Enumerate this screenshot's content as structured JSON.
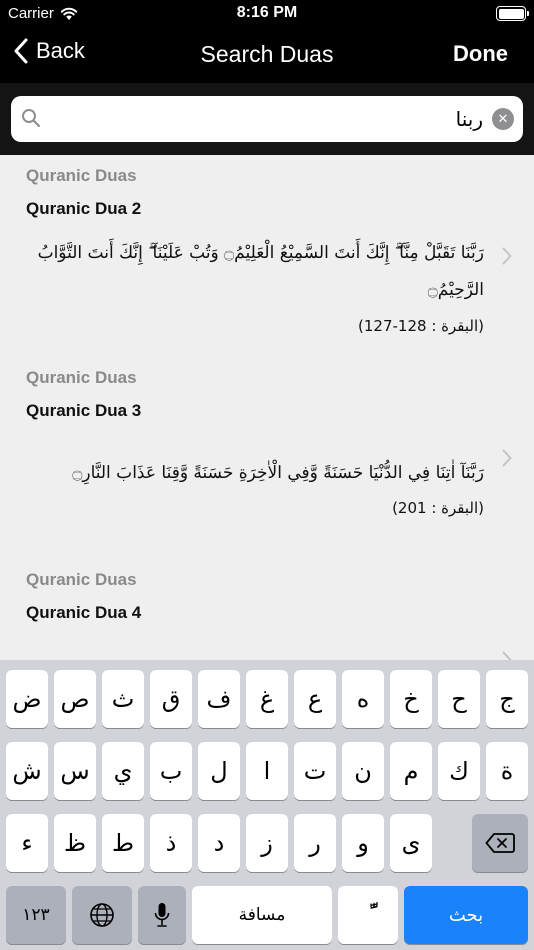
{
  "status": {
    "carrier": "Carrier",
    "time": "8:16 PM"
  },
  "nav": {
    "back_label": "Back",
    "title": "Search Duas",
    "done_label": "Done"
  },
  "search": {
    "value": "ربنا"
  },
  "results": [
    {
      "category": "Quranic Duas",
      "title": "Quranic Dua 2",
      "arabic": "رَبَّنَا تَقَبَّلْ مِنَّآ ۖ إِنَّكَ أَنتَ السَّمِيْعُ الْعَلِيْمُ۝ وَتُبْ عَلَيْنَآ ۖ إِنَّكَ أَنتَ التَّوَّابُ الرَّحِيْمُ۝",
      "reference": "(البقرة : 128-127)"
    },
    {
      "category": "Quranic Duas",
      "title": "Quranic Dua 3",
      "arabic": "رَبَّنَآ اٰتِنَا فِي الدُّنْيَا حَسَنَةً وَّفِي الْاٰخِرَةِ حَسَنَةً وَّقِنَا عَذَابَ النَّارِ۝",
      "reference": "(البقرة : 201)"
    },
    {
      "category": "Quranic Duas",
      "title": "Quranic Dua 4"
    }
  ],
  "keyboard": {
    "row1": [
      "ض",
      "ص",
      "ث",
      "ق",
      "ف",
      "غ",
      "ع",
      "ه",
      "خ",
      "ح",
      "ج"
    ],
    "row2": [
      "ش",
      "س",
      "ي",
      "ب",
      "ل",
      "ا",
      "ت",
      "ن",
      "م",
      "ك",
      "ة"
    ],
    "row3": [
      "ء",
      "ظ",
      "ط",
      "ذ",
      "د",
      "ز",
      "ر",
      "و",
      "ى"
    ],
    "numbers_label": "١٢٣",
    "space_label": "مسافة",
    "diacritic_label": "ًّ",
    "search_label": "بحث"
  }
}
